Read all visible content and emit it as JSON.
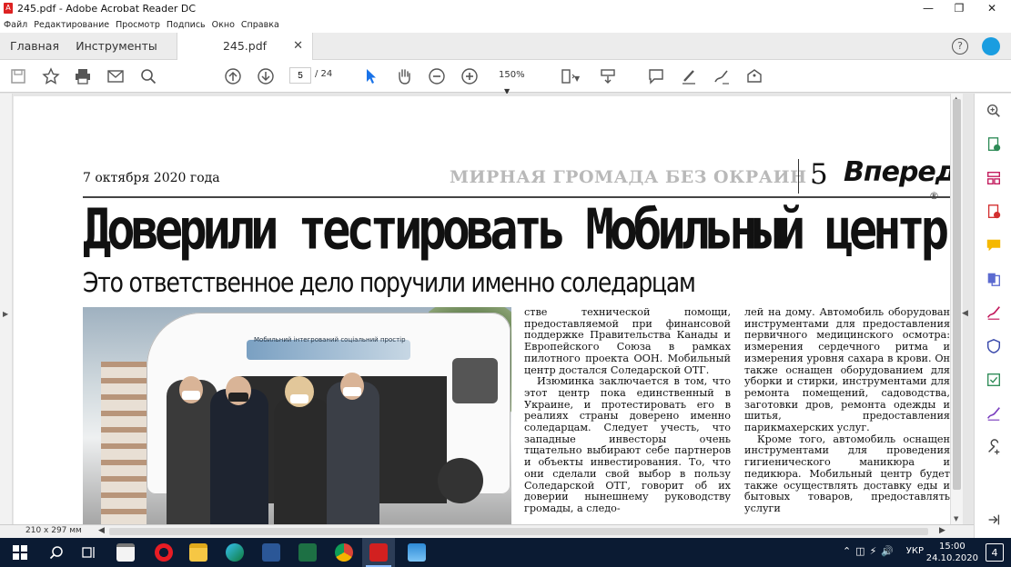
{
  "window": {
    "title": "245.pdf - Adobe Acrobat Reader DC"
  },
  "menu": [
    "Файл",
    "Редактирование",
    "Просмотр",
    "Подпись",
    "Окно",
    "Справка"
  ],
  "tabs": {
    "home": "Главная",
    "tools": "Инструменты",
    "document": "245.pdf"
  },
  "toolbar": {
    "page_current": "5",
    "page_total": "/ 24",
    "zoom": "150%"
  },
  "status": {
    "page_size": "210 x 297 мм"
  },
  "taskbar": {
    "lang": "УКР",
    "time": "15:00",
    "date": "24.10.2020",
    "notifications": "4"
  },
  "article": {
    "date": "7 октября 2020 года",
    "rubric": "МИРНАЯ ГРОМАДА БЕЗ ОКРАИН",
    "page_number": "5",
    "brand": "Вперед",
    "registered": "®",
    "headline": "Доверили тестировать Мобильный центр",
    "subheadline": "Это ответственное дело поручили именно соледарцам",
    "photo_caption_on_van": "Мобильний інтегрований соціальний простір",
    "col1_p1": "стве технической помощи, предоставляемой при финансовой поддержке Правительства Канады и Европейского Союза в рамках пилотного проекта ООН. Мобильный центр достался Соледарской ОТГ.",
    "col1_p2": "Изюминка заключается в том, что этот центр пока единственный в Украине, и протестировать его в реалиях страны доверено именно соледарцам. Следует учесть, что западные инвесторы очень тщательно выбирают себе партнеров и объекты инвестирования. То, что они сделали свой выбор в пользу Соледарской ОТГ, говорит об их доверии нынешнему руководству громады, а следо-",
    "col2_p1": "лей на дому. Автомобиль оборудован инструментами для предоставления первичного медицинского осмотра: измерения сердечного ритма и измерения уровня сахара в крови. Он также оснащен оборудованием для уборки и стирки, инструментами для ремонта помещений, садоводства, заготовки дров, ремонта одежды и шитья, предоставления парикмахерских услуг.",
    "col2_p2": "Кроме того, автомобиль оснащен инструментами для проведения гигиенического маникюра и педикюра. Мобильный центр будет также осуществлять доставку еды и бытовых товаров, предоставлять услуги"
  },
  "colors": {
    "acrobat_red": "#d22020",
    "taskbar": "#0b1b33",
    "accent_blue": "#1a73e8"
  }
}
